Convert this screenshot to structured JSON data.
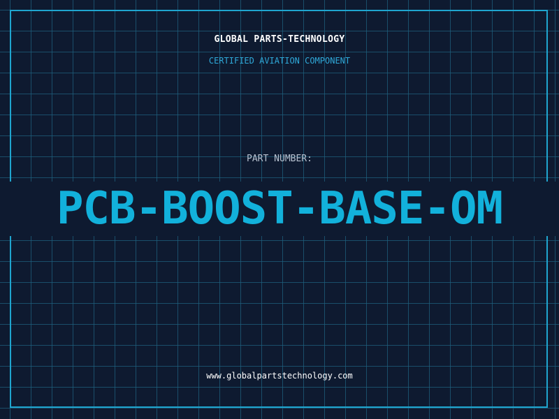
{
  "header": {
    "company": "GLOBAL PARTS-TECHNOLOGY",
    "subtitle": "CERTIFIED AVIATION COMPONENT"
  },
  "part": {
    "label": "PART NUMBER:",
    "number": "PCB-BOOST-BASE-OM"
  },
  "footer": {
    "website": "www.globalpartstechnology.com"
  },
  "colors": {
    "background": "#0e1a30",
    "grid": "#1e5f7d",
    "accent": "#12b1db",
    "frame": "#1fa5cf"
  }
}
